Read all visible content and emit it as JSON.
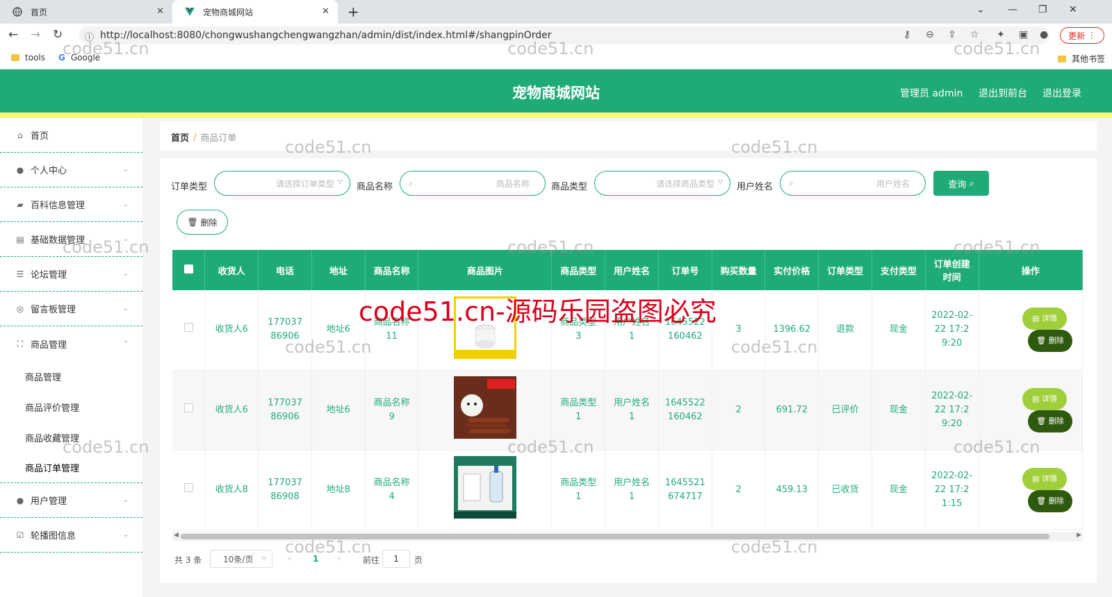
{
  "browser": {
    "tabs": [
      {
        "label": "首页",
        "icon": "globe-icon"
      },
      {
        "label": "宠物商城网站",
        "icon": "vue-icon"
      }
    ],
    "url": "http://localhost:8080/chongwushangchengwangzhan/admin/dist/index.html#/shangpinOrder",
    "update_label": "更新",
    "bookmarks": [
      {
        "label": "tools",
        "icon": "folder-icon"
      },
      {
        "label": "Google",
        "icon": "google-icon"
      }
    ],
    "other_bookmarks": "其他书签"
  },
  "header": {
    "title": "宠物商城网站",
    "user_label": "管理员 admin",
    "front_label": "退出到前台",
    "logout_label": "退出登录",
    "accent_color": "#1fab77"
  },
  "sidebar": {
    "items": [
      {
        "label": "首页",
        "icon": "home-icon"
      },
      {
        "label": "个人中心",
        "icon": "user-icon"
      },
      {
        "label": "百科信息管理",
        "icon": "book-icon"
      },
      {
        "label": "基础数据管理",
        "icon": "data-icon"
      },
      {
        "label": "论坛管理",
        "icon": "list-icon"
      },
      {
        "label": "留言板管理",
        "icon": "compass-icon"
      },
      {
        "label": "商品管理",
        "icon": "fullscreen-icon"
      }
    ],
    "sub_items": [
      "商品管理",
      "商品评价管理",
      "商品收藏管理",
      "商品订单管理"
    ],
    "bottom_items": [
      {
        "label": "用户管理",
        "icon": "user-icon"
      },
      {
        "label": "轮播图信息",
        "icon": "check-icon"
      }
    ]
  },
  "breadcrumb": {
    "home": "首页",
    "sep": "/",
    "current": "商品订单"
  },
  "filters": {
    "order_type_label": "订单类型",
    "order_type_placeholder": "请选择订单类型",
    "goods_name_label": "商品名称",
    "goods_name_placeholder": "商品名称",
    "goods_type_label": "商品类型",
    "goods_type_placeholder": "请选择商品类型",
    "user_name_label": "用户姓名",
    "user_name_placeholder": "用户姓名",
    "query_label": "查询",
    "delete_label": "删除"
  },
  "table": {
    "headers": [
      "收货人",
      "电话",
      "地址",
      "商品名称",
      "商品图片",
      "商品类型",
      "用户姓名",
      "订单号",
      "购买数量",
      "实付价格",
      "订单类型",
      "支付类型",
      "订单创建时间",
      "操作"
    ],
    "rows": [
      {
        "receiver": "收货人6",
        "phone": "17703786906",
        "address": "地址6",
        "goods_name": "商品名称11",
        "goods_type": "商品类型3",
        "user": "用户姓名1",
        "order_no": "1645522160462",
        "qty": "3",
        "price": "1396.62",
        "order_type": "退款",
        "pay_type": "现金",
        "created": "2022-02-22 17:29:20"
      },
      {
        "receiver": "收货人6",
        "phone": "17703786906",
        "address": "地址6",
        "goods_name": "商品名称9",
        "goods_type": "商品类型1",
        "user": "用户姓名1",
        "order_no": "1645522160462",
        "qty": "2",
        "price": "691.72",
        "order_type": "已评价",
        "pay_type": "现金",
        "created": "2022-02-22 17:29:20"
      },
      {
        "receiver": "收货人8",
        "phone": "17703786908",
        "address": "地址8",
        "goods_name": "商品名称4",
        "goods_type": "商品类型1",
        "user": "用户姓名1",
        "order_no": "1645521674717",
        "qty": "2",
        "price": "459.13",
        "order_type": "已收货",
        "pay_type": "现金",
        "created": "2022-02-22 17:21:15"
      }
    ],
    "detail_label": "详情",
    "delete_label": "删除"
  },
  "pagination": {
    "total": "共 3 条",
    "page_size": "10条/页",
    "current_page": "1",
    "goto_label": "前往",
    "goto_value": "1",
    "page_suffix": "页"
  },
  "watermark": {
    "small": "code51.cn",
    "big": "code51.cn-源码乐园盗图必究"
  }
}
